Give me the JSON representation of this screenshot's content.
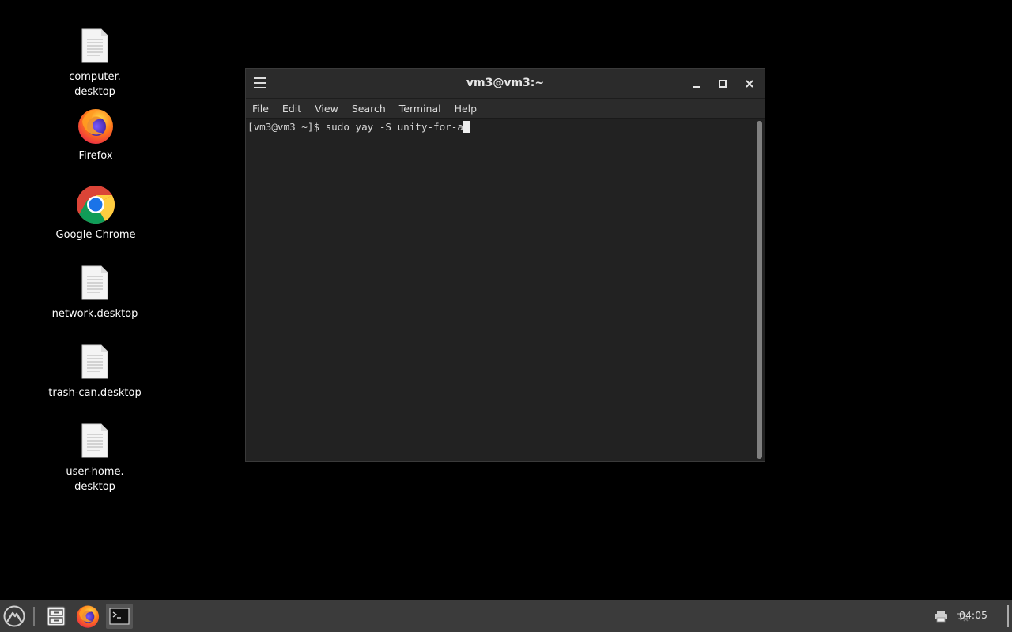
{
  "desktop": {
    "icons": [
      {
        "label": "computer.\ndesktop",
        "icon": "text-file-icon"
      },
      {
        "label": "Firefox",
        "icon": "firefox-icon"
      },
      {
        "label": "Google Chrome",
        "icon": "chrome-icon"
      },
      {
        "label": "network.desktop",
        "icon": "text-file-icon"
      },
      {
        "label": "trash-can.desktop",
        "icon": "text-file-icon"
      },
      {
        "label": "user-home.\ndesktop",
        "icon": "text-file-icon"
      }
    ]
  },
  "terminal": {
    "title": "vm3@vm3:~",
    "menu": [
      "File",
      "Edit",
      "View",
      "Search",
      "Terminal",
      "Help"
    ],
    "prompt": "[vm3@vm3 ~]$ ",
    "command": "sudo yay -S unity-for-a"
  },
  "taskbar": {
    "clock": "04:05",
    "items": [
      "start-menu-icon",
      "file-manager-icon",
      "firefox-icon",
      "terminal-icon"
    ],
    "tray": [
      "printer-icon",
      "network-icon"
    ]
  },
  "colors": {
    "desktop_bg": "#000000",
    "terminal_bg": "#222222",
    "titlebar_bg": "#2b2b2b",
    "taskbar_bg": "#3b3b3b"
  }
}
